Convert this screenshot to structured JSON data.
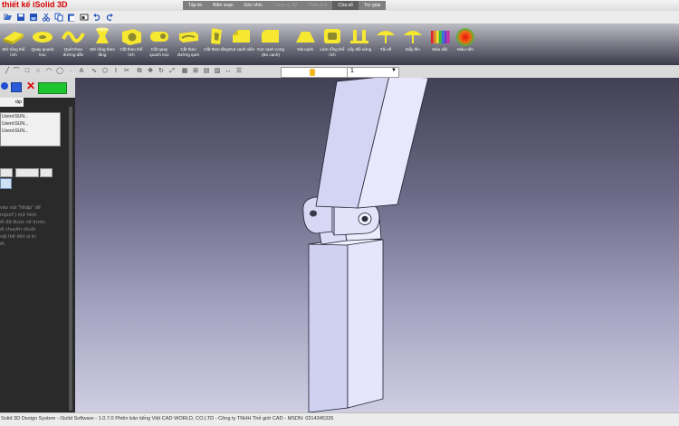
{
  "window": {
    "title": "thiết kế iSolid 3D"
  },
  "menu": [
    {
      "label": "Tập tin",
      "state": "normal"
    },
    {
      "label": "Biên soạn",
      "state": "normal"
    },
    {
      "label": "Góc nhìn",
      "state": "normal"
    },
    {
      "label": "Công cụ 3D",
      "state": "disabled"
    },
    {
      "label": "Phân tích",
      "state": "disabled"
    },
    {
      "label": "Cửa sổ",
      "state": "active"
    },
    {
      "label": "Trợ giúp",
      "state": "normal"
    }
  ],
  "quick_toolbar": [
    {
      "icon": "open-icon"
    },
    {
      "icon": "save-icon"
    },
    {
      "icon": "save-as-icon"
    },
    {
      "icon": "cut-icon"
    },
    {
      "icon": "copy-icon"
    },
    {
      "icon": "paste-icon"
    },
    {
      "icon": "shape-icon"
    },
    {
      "icon": "undo-icon"
    },
    {
      "icon": "redo-icon"
    }
  ],
  "ribbon": {
    "tools": [
      {
        "label": "Mở rộng thể tích",
        "icon": "extrude-icon"
      },
      {
        "label": "Quay quanh trục",
        "icon": "revolve-icon"
      },
      {
        "label": "Quét theo đường dẫn",
        "icon": "sweep-icon"
      },
      {
        "label": "Mở rộng theo tầng",
        "icon": "loft-icon"
      },
      {
        "label": "Cắt theo thể tích",
        "icon": "cut-extrude-icon"
      },
      {
        "label": "Cắt quay quanh trục",
        "icon": "cut-revolve-icon"
      },
      {
        "label": "Cắt theo đường quét",
        "icon": "cut-sweep-icon"
      },
      {
        "label": "Cắt theo tầng",
        "icon": "cut-loft-icon"
      },
      {
        "label": "Gọt cạnh xiên",
        "icon": "chamfer-icon"
      },
      {
        "label": "Gọt cạnh cong (Bo cạnh)",
        "icon": "fillet-icon"
      },
      {
        "label": "Vát cạnh",
        "icon": "bevel-icon"
      },
      {
        "label": "Làm rỗng thể tích",
        "icon": "shell-icon"
      },
      {
        "label": "Lấy đối xứng",
        "icon": "mirror-icon"
      },
      {
        "label": "Tải về",
        "icon": "download-icon"
      },
      {
        "label": "Đẩy lên",
        "icon": "upload-icon"
      },
      {
        "label": "Màu sắc",
        "icon": "color-icon"
      },
      {
        "label": "Màu nền",
        "icon": "background-color-icon"
      }
    ]
  },
  "format_bar": {
    "line_width": "1"
  },
  "left_panel": {
    "tab_label": "rập",
    "files": [
      "Users\\SUN...",
      "Users\\SUN...",
      "Users\\SUN..."
    ],
    "instructions": [
      "vào nút \"Nhập\" để",
      "mport\") mở hình",
      "ết đã được vẽ trước.",
      "đi chuyển chuột",
      "vật thể đến vị trí",
      "ết."
    ]
  },
  "status": {
    "text": "Solid 3D Design System - iSolid Software - 1.0.7.0 Phiên bản tiếng Việt CAD WORLD, CO.LTD - Công ty TNHH Thế giới CAD - MSDN: 0314345326"
  },
  "colors": {
    "title_red": "#d60000",
    "ribbon_yellow": "#f2e11a",
    "part_face": "#d4d4f4",
    "background_top": "#424154",
    "background_bottom": "#cfcee2"
  }
}
